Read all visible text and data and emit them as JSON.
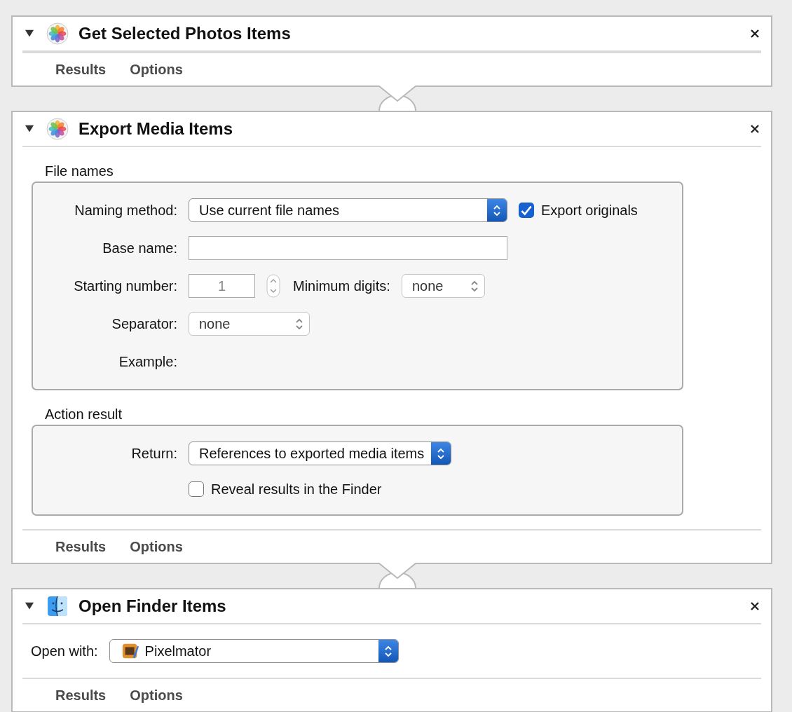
{
  "actions": [
    {
      "title": "Get Selected Photos Items",
      "expanded": true,
      "footer": [
        "Results",
        "Options"
      ]
    },
    {
      "title": "Export Media Items",
      "expanded": true,
      "groups": [
        {
          "title": "File names",
          "rows": [
            {
              "label": "Naming method:",
              "controls": [
                {
                  "kind": "popup",
                  "value": "Use current file names",
                  "disabled": false
                },
                {
                  "kind": "checkbox",
                  "label": "Export originals",
                  "checked": true
                }
              ]
            },
            {
              "label": "Base name:",
              "controls": [
                {
                  "kind": "text_field"
                }
              ]
            },
            {
              "label": "Starting number:",
              "controls": [
                {
                  "kind": "number_field",
                  "value": "1",
                  "disabled": true
                },
                {
                  "kind": "stepper",
                  "disabled": true
                },
                {
                  "kind": "label",
                  "text": "Minimum digits:"
                },
                {
                  "kind": "popup",
                  "value": "none",
                  "disabled": true
                }
              ]
            },
            {
              "label": "Separator:",
              "controls": [
                {
                  "kind": "popup",
                  "value": "none",
                  "disabled": true
                }
              ]
            },
            {
              "label": "Example:",
              "controls": []
            }
          ]
        },
        {
          "title": "Action result",
          "rows": [
            {
              "label": "Return:",
              "controls": [
                {
                  "kind": "popup",
                  "value": "References to exported media items",
                  "disabled": false
                }
              ]
            },
            {
              "controls": [
                {
                  "kind": "checkbox",
                  "label": "Reveal results in the Finder",
                  "checked": false
                }
              ]
            }
          ]
        }
      ],
      "footer": [
        "Results",
        "Options"
      ]
    },
    {
      "title": "Open Finder Items",
      "expanded": true,
      "rows": [
        {
          "label": "Open with:",
          "controls": [
            {
              "kind": "popup",
              "value": "Pixelmator",
              "disabled": false
            }
          ]
        }
      ],
      "footer": [
        "Results",
        "Options"
      ]
    }
  ]
}
